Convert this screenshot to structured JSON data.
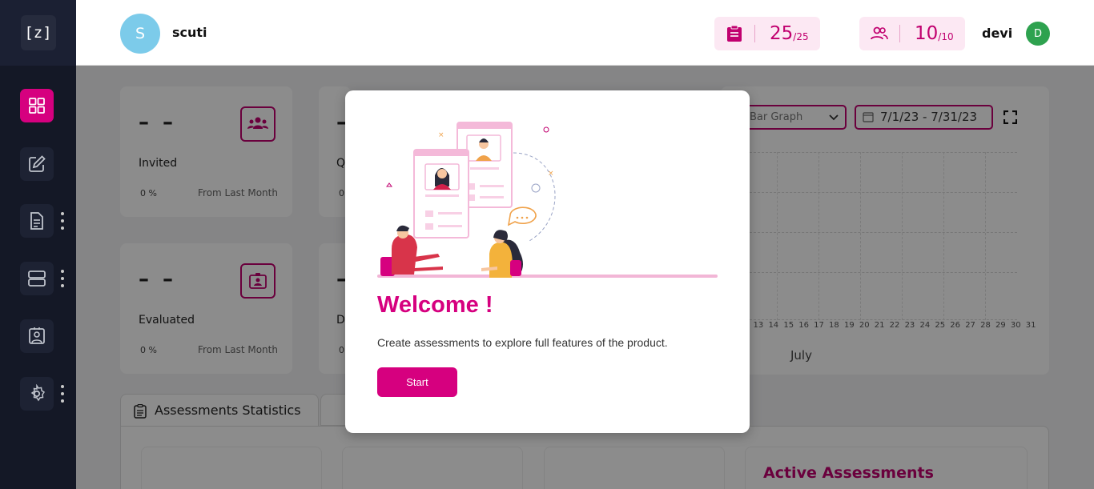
{
  "sidebar": {
    "logo": "[z]",
    "items": [
      {
        "icon": "dashboard-grid-icon",
        "active": true
      },
      {
        "icon": "edit-icon",
        "active": false
      },
      {
        "icon": "document-icon",
        "active": false,
        "menu": true
      },
      {
        "icon": "server-icon",
        "active": false,
        "menu": true
      },
      {
        "icon": "id-badge-icon",
        "active": false
      },
      {
        "icon": "settings-icon",
        "active": false,
        "menu": true
      }
    ]
  },
  "header": {
    "org_initial": "S",
    "org_name": "scuti",
    "assessments_counter": {
      "value": "25",
      "max": "/25"
    },
    "users_counter": {
      "value": "10",
      "max": "/10"
    },
    "user_name": "devi",
    "user_initial": "D"
  },
  "stats": [
    {
      "value": "– –",
      "label": "Invited",
      "pct": "0 %",
      "from": "From Last Month",
      "icon": "group-icon"
    },
    {
      "value": "– –",
      "label": "Evaluated",
      "pct": "0 %",
      "from": "From Last Month",
      "icon": "badge-icon"
    },
    {
      "value": "–",
      "label": "Q",
      "pct": "0"
    },
    {
      "value": "–",
      "label": "D",
      "pct": "0"
    }
  ],
  "chart_controls": {
    "graph_type": "Bar Graph",
    "date_range": "7/1/23 - 7/31/23"
  },
  "chart": {
    "x_ticks": "2 13 14 15 16 17 18 19 20 21 22 23 24 25 26 27 28 29 30 31",
    "x_title": "July"
  },
  "tabs": {
    "active": "Assessments Statistics"
  },
  "active_assessments_title": "Active Assessments",
  "modal": {
    "title": "Welcome !",
    "description": "Create assessments to explore full features of the product.",
    "start_label": "Start"
  },
  "colors": {
    "brand": "#d6007f",
    "sidebar": "#141826",
    "success": "#2ea24f"
  }
}
